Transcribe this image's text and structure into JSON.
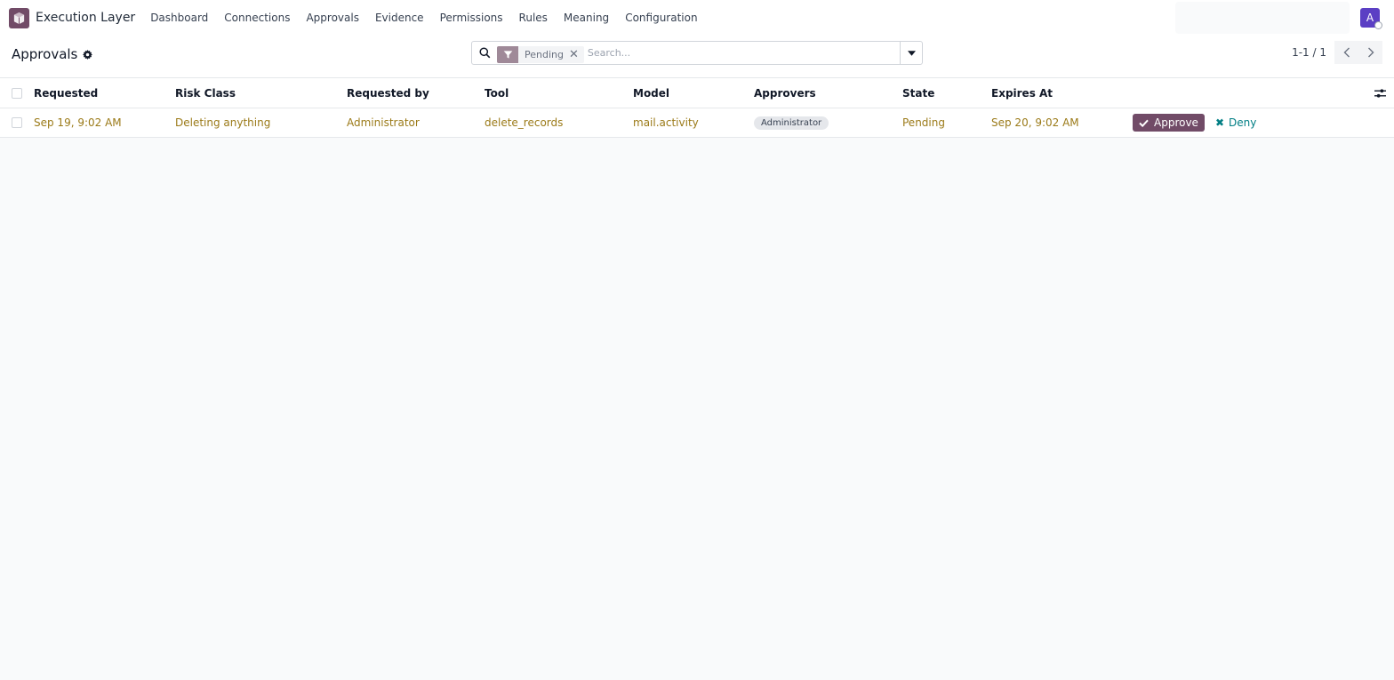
{
  "navbar": {
    "app_name": "Execution Layer",
    "menu": [
      "Dashboard",
      "Connections",
      "Approvals",
      "Evidence",
      "Permissions",
      "Rules",
      "Meaning",
      "Configuration"
    ],
    "avatar_letter": "A"
  },
  "control": {
    "title": "Approvals",
    "search": {
      "facet_value": "Pending",
      "placeholder": "Search..."
    },
    "pager": "1-1 / 1"
  },
  "table": {
    "columns": [
      "Requested",
      "Risk Class",
      "Requested by",
      "Tool",
      "Model",
      "Approvers",
      "State",
      "Expires At"
    ],
    "rows": [
      {
        "requested": "Sep 19, 9:02 AM",
        "risk_class": "Deleting anything",
        "requested_by": "Administrator",
        "tool": "delete_records",
        "model": "mail.activity",
        "approver": "Administrator",
        "state": "Pending",
        "expires_at": "Sep 20, 9:02 AM",
        "approve_label": "Approve",
        "deny_label": "Deny"
      }
    ]
  },
  "colors": {
    "brand": "#714b67",
    "link_text": "#9b7a18",
    "deny": "#017e84",
    "avatar": "#5b3fc4"
  }
}
